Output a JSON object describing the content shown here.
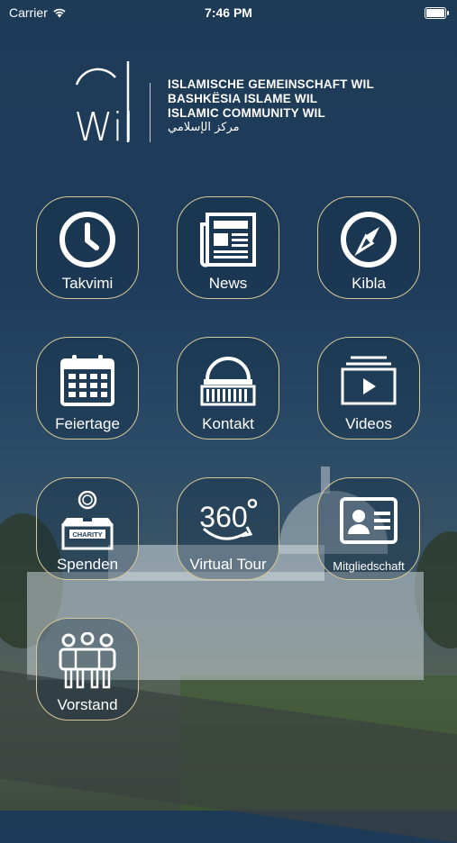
{
  "status_bar": {
    "carrier": "Carrier",
    "time": "7:46 PM"
  },
  "header": {
    "logo_text": "Wil",
    "lines": [
      "ISLAMISCHE GEMEINSCHAFT WIL",
      "BASHKËSIA ISLAME WIL",
      "ISLAMIC COMMUNITY WIL",
      "مركز الإسلامي"
    ]
  },
  "tiles": [
    {
      "label": "Takvimi",
      "icon": "clock-icon"
    },
    {
      "label": "News",
      "icon": "newspaper-icon"
    },
    {
      "label": "Kibla",
      "icon": "compass-icon"
    },
    {
      "label": "Feiertage",
      "icon": "calendar-icon"
    },
    {
      "label": "Kontakt",
      "icon": "mosque-dome-icon"
    },
    {
      "label": "Videos",
      "icon": "video-play-icon"
    },
    {
      "label": "Spenden",
      "icon": "charity-box-icon",
      "icon_text": "CHARITY"
    },
    {
      "label": "Virtual Tour",
      "icon": "360-tour-icon",
      "icon_text": "360"
    },
    {
      "label": "Mitgliedschaft",
      "icon": "member-card-icon"
    },
    {
      "label": "Vorstand",
      "icon": "group-icon"
    }
  ],
  "colors": {
    "tile_border": "#d6c89a",
    "background_top": "#1d3a57"
  }
}
